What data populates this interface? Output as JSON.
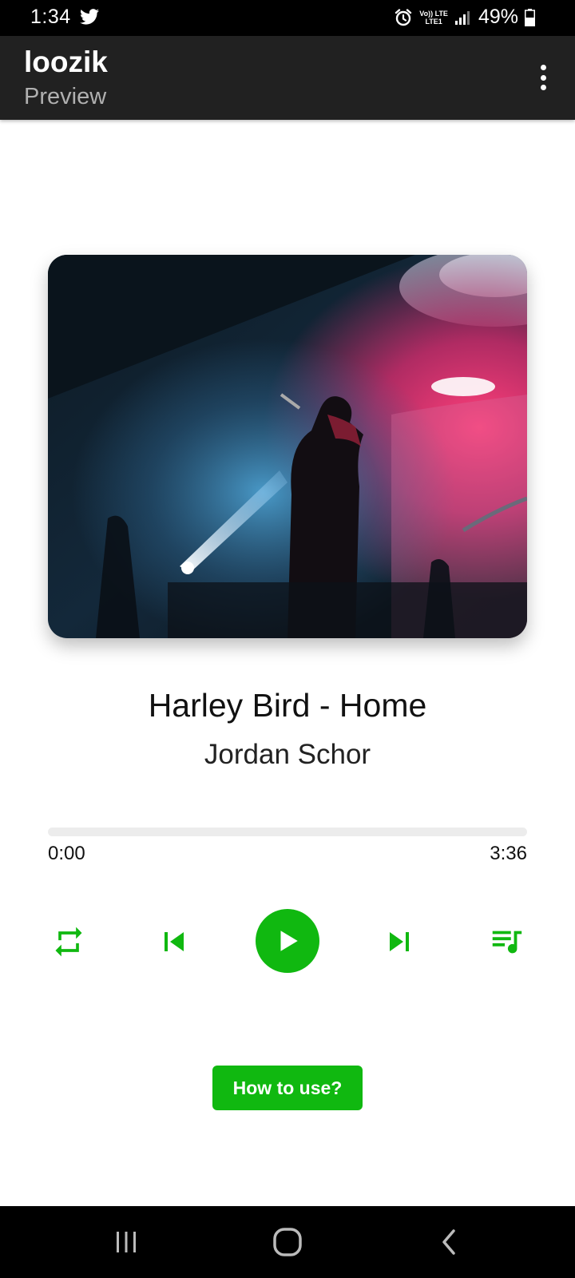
{
  "status_bar": {
    "time": "1:34",
    "battery": "49%",
    "network_line1": "Vo)) LTE",
    "network_line2": "LTE1",
    "icons": [
      "twitter-icon",
      "alarm-icon",
      "signal-icon",
      "battery-icon"
    ]
  },
  "app_bar": {
    "title": "loozik",
    "subtitle": "Preview",
    "menu_icon": "more-vert-icon"
  },
  "player": {
    "album_art_alt": "concert-performer-image",
    "track_title": "Harley Bird - Home",
    "artist": "Jordan Schor",
    "progress_fraction": 0,
    "time_elapsed": "0:00",
    "time_total": "3:36",
    "controls": {
      "repeat_icon": "repeat-icon",
      "previous_icon": "skip-previous-icon",
      "play_icon": "play-icon",
      "next_icon": "skip-next-icon",
      "queue_icon": "queue-music-icon"
    }
  },
  "how_to_use_label": "How to use?",
  "nav_bar": {
    "icons": [
      "recents-icon",
      "home-icon",
      "back-icon"
    ]
  },
  "colors": {
    "accent": "#10b810",
    "app_bar": "#212121",
    "system_bar": "#000000",
    "progress_track": "#ececec"
  }
}
